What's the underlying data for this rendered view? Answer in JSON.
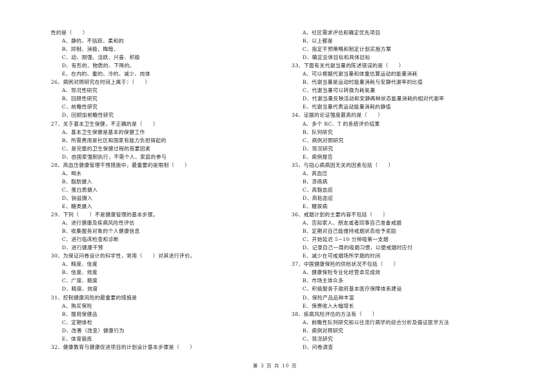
{
  "left_column": [
    {
      "type": "q",
      "text": "性的是（　　）"
    },
    {
      "type": "o",
      "text": "A、静的、不括跃、柔和的"
    },
    {
      "type": "o",
      "text": "B、抑制、消极、晦暗、"
    },
    {
      "type": "o",
      "text": "C、动、刚强、活跃、兴奋、积极"
    },
    {
      "type": "o",
      "text": "D、有形的、物质的、下降的、"
    },
    {
      "type": "o",
      "text": "E、在内的、重的、冷的、减少、肉体"
    },
    {
      "type": "q",
      "text": "26、病例对照研究在时间上属于：（　　）"
    },
    {
      "type": "o",
      "text": "A、现况性研究"
    },
    {
      "type": "o",
      "text": "B、回顾性研究"
    },
    {
      "type": "o",
      "text": "C、前瞻性研究"
    },
    {
      "type": "o",
      "text": "D、回顾加前瞻性研究"
    },
    {
      "type": "q",
      "text": "27、关于基本卫生保健，不正确的是（　　）"
    },
    {
      "type": "o",
      "text": "A、基本卫生保健是基本的保健工作"
    },
    {
      "type": "o",
      "text": "B、所需费用是社区和国家有能力负担得起的"
    },
    {
      "type": "o",
      "text": "C、是完整的卫生保健过程的首要因素"
    },
    {
      "type": "o",
      "text": "D、由国家强制执行，不需个人、家庭的参与"
    },
    {
      "type": "q",
      "text": "28、高血压健康管理干预措施中，最重要的是限制（　　）"
    },
    {
      "type": "o",
      "text": "A、喝水"
    },
    {
      "type": "o",
      "text": "B、脂肪摄入"
    },
    {
      "type": "o",
      "text": "C、蛋白质摄入"
    },
    {
      "type": "o",
      "text": "D、钠盐摄入"
    },
    {
      "type": "o",
      "text": "E、糖类摄入"
    },
    {
      "type": "q",
      "text": "29、下列（　　）不是健康管理的基本步骤。"
    },
    {
      "type": "o",
      "text": "A、进行健康及疾病风险性评估"
    },
    {
      "type": "o",
      "text": "B、收集服务对象的个人健康信息"
    },
    {
      "type": "o",
      "text": "C、进行临床检查和诊断"
    },
    {
      "type": "o",
      "text": "D、进行健康干预"
    },
    {
      "type": "q",
      "text": "30、为保证问卷设计的科学性，常用（　　）对其进行评价。"
    },
    {
      "type": "o",
      "text": "A、精度、信度"
    },
    {
      "type": "o",
      "text": "B、信度、效度"
    },
    {
      "type": "o",
      "text": "C、广度、精度"
    },
    {
      "type": "o",
      "text": "D、精度、效度"
    },
    {
      "type": "q",
      "text": "31、控制健康风险的最重要的措施是"
    },
    {
      "type": "o",
      "text": "A、购买保险"
    },
    {
      "type": "o",
      "text": "B、服用保健品"
    },
    {
      "type": "o",
      "text": "C、定期体检"
    },
    {
      "type": "o",
      "text": "D、改善（改变）健康行为"
    },
    {
      "type": "o",
      "text": "E、体育锻炼"
    },
    {
      "type": "q",
      "text": "32、健康教育与健康促进项目的计划设计基本步骤是（　　）"
    }
  ],
  "right_column": [
    {
      "type": "o",
      "text": "A、社区需求评估和确定优先项目"
    },
    {
      "type": "o",
      "text": "B、以上都是"
    },
    {
      "type": "o",
      "text": "C、指定干预策略和制定计划实施方案"
    },
    {
      "type": "o",
      "text": "D、确定总体目标和具体目标"
    },
    {
      "type": "q",
      "text": "33、下面有关代谢当量的陈述错误的是（　　）"
    },
    {
      "type": "o",
      "text": "A、可以根据代谢当量和体重估算运动的能量消耗"
    },
    {
      "type": "o",
      "text": "B、代谢当量是运动时能量消耗与安静代谢率的比值"
    },
    {
      "type": "o",
      "text": "C、代谢当量可以转换为耗氧量"
    },
    {
      "type": "o",
      "text": "D、代谢当量反映活动和安静两种状态能量消耗的相对代谢率"
    },
    {
      "type": "o",
      "text": "E、代谢当量代表运动能量消耗的静值"
    },
    {
      "type": "q",
      "text": "34、证据的论证强度最高的是（　　）"
    },
    {
      "type": "o",
      "text": "A、多个 RC、T 的系统评价结果"
    },
    {
      "type": "o",
      "text": "B、队列研究"
    },
    {
      "type": "o",
      "text": "C、病例对照研究"
    },
    {
      "type": "o",
      "text": "D、现况研究"
    },
    {
      "type": "o",
      "text": "E、病例报告"
    },
    {
      "type": "q",
      "text": "35、与冠心病病因无关的因素包括（　　）"
    },
    {
      "type": "o",
      "text": "A、高血压"
    },
    {
      "type": "o",
      "text": "B、溃疡病"
    },
    {
      "type": "o",
      "text": "C、高脂血症"
    },
    {
      "type": "o",
      "text": "D、高粘血症"
    },
    {
      "type": "o",
      "text": "E、糖尿病"
    },
    {
      "type": "q",
      "text": "36、戒烟计划的主要内容不包括（　　）"
    },
    {
      "type": "o",
      "text": "A、告知家人、朋友或者同事自己准备戒烟"
    },
    {
      "type": "o",
      "text": "B、定期对自己能维持戒烟状态给予奖励"
    },
    {
      "type": "o",
      "text": "C、开始延迟 5~10 分钟吸第一支烟"
    },
    {
      "type": "o",
      "text": "D、记录自己一周的吸烟习惯，以便戒烟时应付"
    },
    {
      "type": "o",
      "text": "E、减少在可戒烟场所学烟的时间"
    },
    {
      "type": "q",
      "text": "37、中国健康保险的供给状况不包括（　　）"
    },
    {
      "type": "o",
      "text": "A、健康保险专业化经营卓见成效"
    },
    {
      "type": "o",
      "text": "B、市场主体众多"
    },
    {
      "type": "o",
      "text": "C、积极服务于政府基本医疗保障体系建设"
    },
    {
      "type": "o",
      "text": "D、保险产品品种丰富"
    },
    {
      "type": "o",
      "text": "E、保费收入大幅增长"
    },
    {
      "type": "q",
      "text": "38、疾病风险评估的方法有（　　）"
    },
    {
      "type": "o",
      "text": "A、前瞻性队列研究和以往流行病学的综合分析及循证医学方法"
    },
    {
      "type": "o",
      "text": "B、病例对照研究"
    },
    {
      "type": "o",
      "text": "C、现况研究"
    },
    {
      "type": "o",
      "text": "D、问卷调查"
    }
  ],
  "footer": {
    "page_label": "第 3 页 共 10 页"
  }
}
